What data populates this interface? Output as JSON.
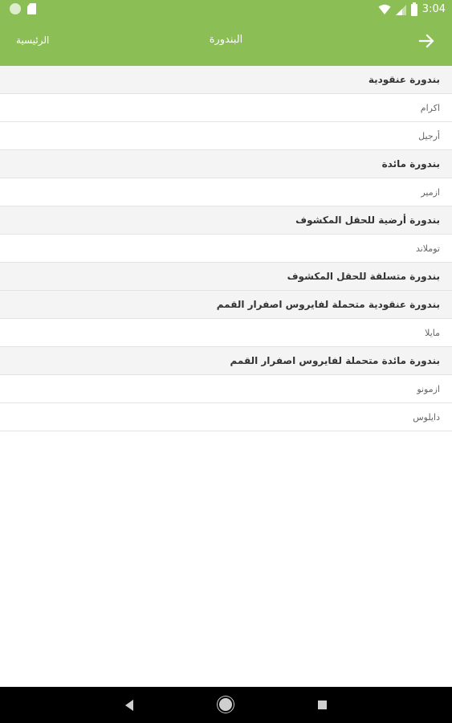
{
  "status_bar": {
    "time": "3:04",
    "icons": [
      "notification-dot-icon",
      "sd-card-icon",
      "wifi-icon",
      "signal-icon",
      "battery-icon"
    ]
  },
  "app_bar": {
    "home_label": "الرئيسية",
    "title": "البندورة",
    "back_icon": "arrow-right-icon",
    "color": "#8bbf56"
  },
  "list": {
    "rows": [
      {
        "kind": "header",
        "text": "بندورة عنقودية"
      },
      {
        "kind": "item",
        "text": "اكرام"
      },
      {
        "kind": "item",
        "text": "أرجيل"
      },
      {
        "kind": "header",
        "text": "بندورة مائدة"
      },
      {
        "kind": "item",
        "text": "ازمير"
      },
      {
        "kind": "header",
        "text": "بندورة أرضية للحقل المكشوف"
      },
      {
        "kind": "item",
        "text": "توملاند"
      },
      {
        "kind": "header",
        "text": "بندورة متسلقة للحقل المكشوف"
      },
      {
        "kind": "header",
        "text": "بندورة عنقودية متحملة لفايروس اصفرار القمم"
      },
      {
        "kind": "item",
        "text": "مايلا"
      },
      {
        "kind": "header",
        "text": "بندورة مائدة متحملة لفايروس اصفرار القمم"
      },
      {
        "kind": "item",
        "text": "ازمونو"
      },
      {
        "kind": "item",
        "text": "دايلوس"
      }
    ]
  },
  "nav_bar": {
    "icons": [
      "nav-back-icon",
      "nav-home-icon",
      "nav-recents-icon"
    ]
  }
}
